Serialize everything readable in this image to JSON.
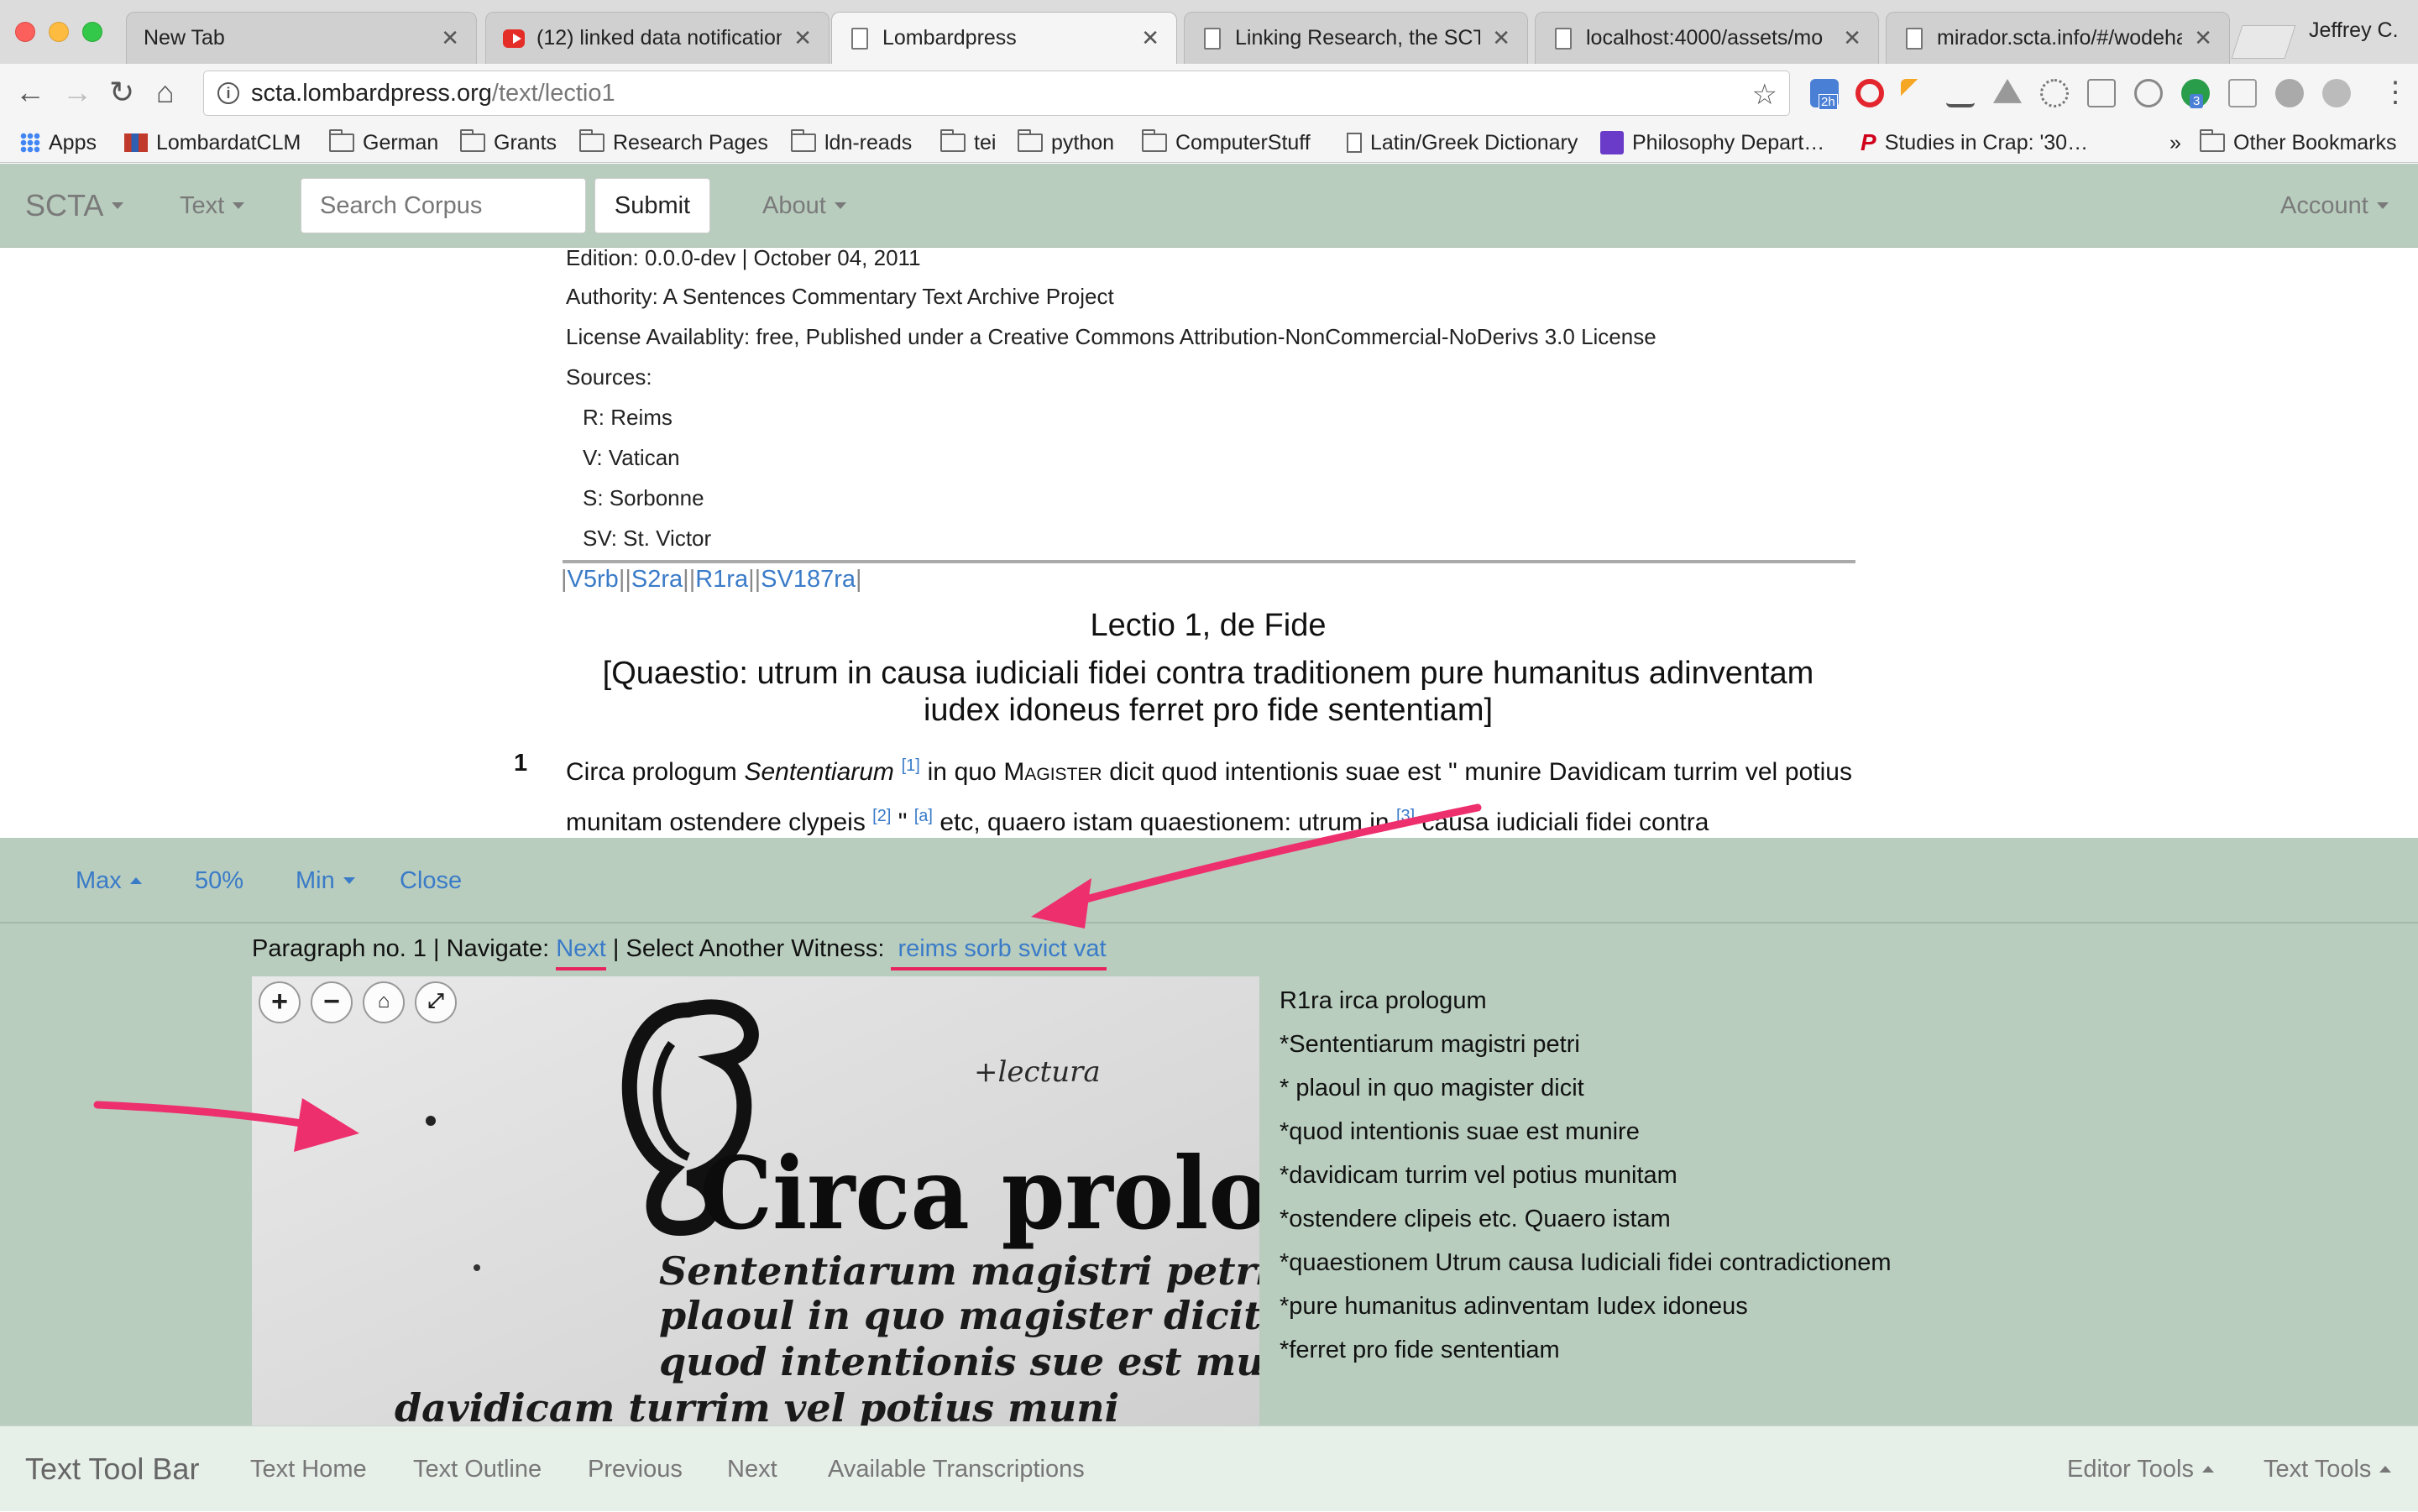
{
  "browser": {
    "tabs": [
      {
        "title": "New Tab",
        "favicon": "blank"
      },
      {
        "title": "(12) linked data notification",
        "favicon": "youtube-icon"
      },
      {
        "title": "Lombardpress",
        "favicon": "page-icon",
        "active": true
      },
      {
        "title": "Linking Research, the SCTA",
        "favicon": "page-icon"
      },
      {
        "title": "localhost:4000/assets/mo",
        "favicon": "page-icon"
      },
      {
        "title": "mirador.scta.info/#/wodeha",
        "favicon": "page-icon"
      }
    ],
    "profile_name": "Jeffrey C.",
    "url_host": "scta.lombardpress.org",
    "url_path": "/text/lectio1",
    "extension_badges": {
      "calendar": "2h",
      "green": "3"
    },
    "bookmarks": [
      {
        "label": "Apps",
        "icon": "apps-icon"
      },
      {
        "label": "LombardatCLM",
        "icon": "library-icon"
      },
      {
        "label": "German",
        "icon": "folder-icon"
      },
      {
        "label": "Grants",
        "icon": "folder-icon"
      },
      {
        "label": "Research Pages",
        "icon": "folder-icon"
      },
      {
        "label": "ldn-reads",
        "icon": "folder-icon"
      },
      {
        "label": "tei",
        "icon": "folder-icon"
      },
      {
        "label": "python",
        "icon": "folder-icon"
      },
      {
        "label": "ComputerStuff",
        "icon": "folder-icon"
      },
      {
        "label": "Latin/Greek Dictionary",
        "icon": "page-icon"
      },
      {
        "label": "Philosophy Depart…",
        "icon": "list-icon"
      },
      {
        "label": "Studies in Crap: '30…",
        "icon": "p-icon"
      }
    ],
    "bookmarks_overflow": "»",
    "other_bookmarks": "Other Bookmarks"
  },
  "navbar": {
    "brand": "SCTA",
    "text_menu": "Text",
    "search_placeholder": "Search Corpus",
    "submit": "Submit",
    "about": "About",
    "account": "Account"
  },
  "document": {
    "edition": "Edition: 0.0.0-dev | October 04, 2011",
    "authority": "Authority: A Sentences Commentary Text Archive Project",
    "license": "License Availablity: free, Published under a Creative Commons Attribution-NonCommercial-NoDerivs 3.0 License",
    "sources_label": "Sources:",
    "sources": [
      "R: Reims",
      "V: Vatican",
      "S: Sorbonne",
      "SV: St. Victor"
    ],
    "witness_links": [
      "V5rb",
      "S2ra",
      "R1ra",
      "SV187ra"
    ],
    "lectio_title": "Lectio 1, de Fide",
    "quaestio": "[Quaestio: utrum in causa iudiciali fidei contra traditionem pure humanitus adinventam iudex idoneus ferret pro fide sententiam]",
    "paragraph_number": "1",
    "paragraph": {
      "p1": "Circa prologum ",
      "p1_italic": "Sententiarum",
      "fn1": "[1]",
      "p2": " in quo ",
      "magister": "Magister",
      "p3": " dicit quod intentionis suae est \" munire Davidicam turrim vel potius munitam ostendere clypeis ",
      "fn2": "[2]",
      "p4": " \" ",
      "fna": "[a]",
      "p5": " etc, quaero istam quaestionem: utrum in ",
      "fn3": "[3]",
      "p6": " causa iudiciali fidei contra"
    }
  },
  "panel": {
    "max": "Max",
    "half": "50%",
    "min": "Min",
    "close": "Close",
    "paragraph_label": "Paragraph no. 1",
    "navigate_label": "| Navigate:",
    "next": "Next",
    "select_witness_label": "| Select Another Witness:",
    "witness_options": "reims sorb svict vat",
    "transcription": [
      "R1ra irca prologum",
      "*Sententiarum magistri petri",
      "* plaoul in quo magister dicit",
      "*quod intentionis suae est munire",
      "*davidicam turrim vel potius munitam",
      "*ostendere clipeis etc. Quaero istam",
      "*quaestionem Utrum causa Iudiciali fidei contradictionem",
      "*pure humanitus adinventam Iudex idoneus",
      "*ferret pro fide sententiam"
    ],
    "manuscript_lines": [
      "Circa prologum",
      "Sententiarum magistri petri",
      "plaoul in quo magister dicit",
      "quod intentionis sue est munire",
      "davidicam turrim vel potius muni"
    ],
    "marginal_note": "+lectura"
  },
  "footer": {
    "brand": "Text Tool Bar",
    "items": [
      "Text Home",
      "Text Outline",
      "Previous",
      "Next",
      "Available Transcriptions"
    ],
    "editor_tools": "Editor Tools",
    "text_tools": "Text Tools"
  },
  "colors": {
    "navbar_bg": "#b8cdbe",
    "link": "#3a7bc8",
    "annotation_arrow": "#ee2f6e"
  }
}
